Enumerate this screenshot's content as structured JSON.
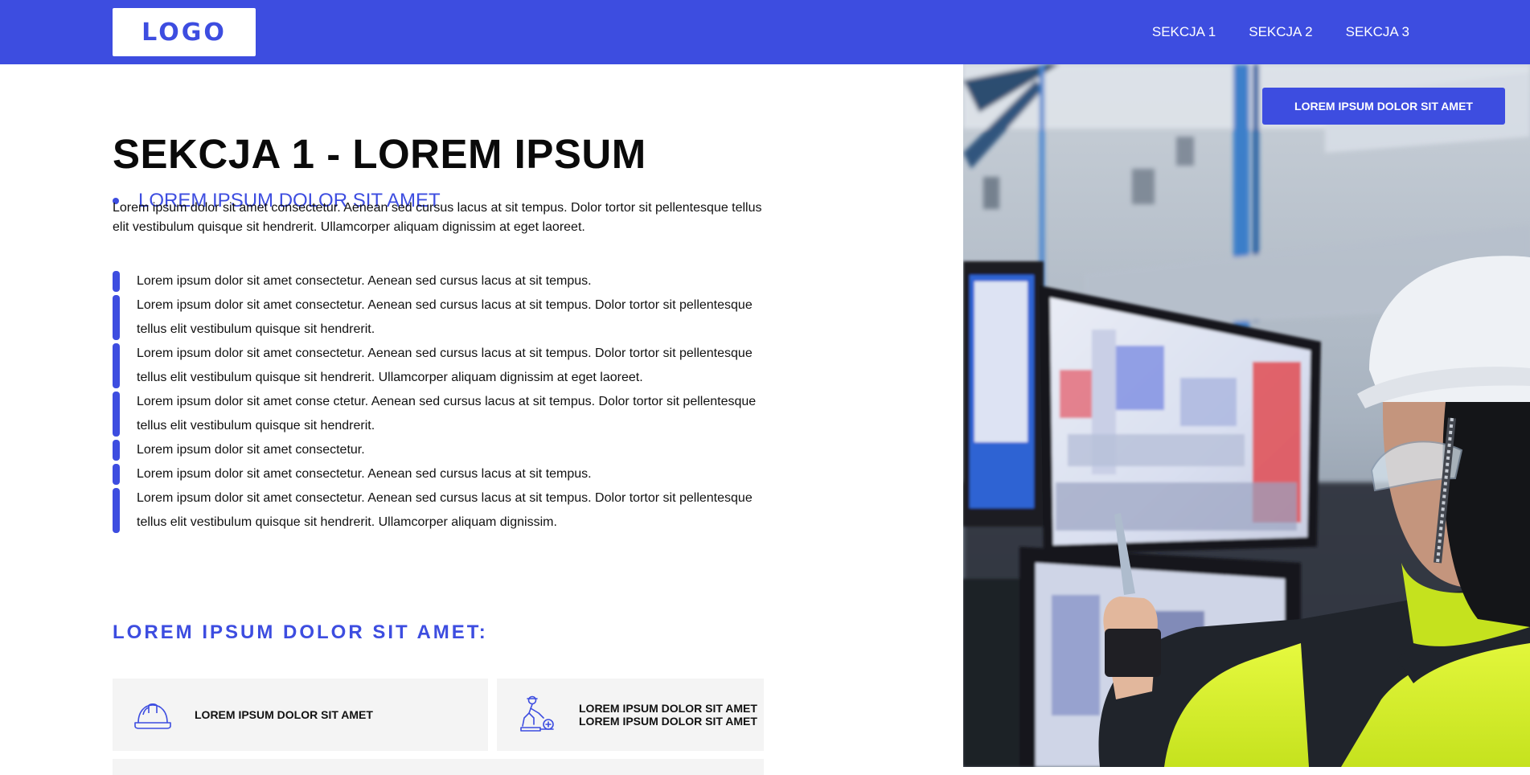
{
  "header": {
    "logo_text": "LOGO",
    "nav": [
      "SEKCJA 1",
      "SEKCJA 2",
      "SEKCJA 3"
    ]
  },
  "main": {
    "title": "SEKCJA 1 - LOREM IPSUM",
    "sub_bullet": "LOREM IPSUM DOLOR SIT AMET",
    "intro": "Lorem ipsum dolor sit amet consectetur. Aenean sed cursus lacus at sit tempus. Dolor tortor sit pellentesque tellus elit vestibulum quisque sit hendrerit. Ullamcorper aliquam dignissim at eget laoreet.",
    "list": [
      "Lorem ipsum dolor sit amet consectetur. Aenean sed cursus lacus at sit tempus.",
      "Lorem ipsum dolor sit amet consectetur. Aenean sed cursus lacus at sit tempus. Dolor tortor sit pellentesque tellus elit vestibulum quisque sit hendrerit.",
      "Lorem ipsum dolor sit amet consectetur. Aenean sed cursus lacus at sit tempus. Dolor tortor sit pellentesque tellus elit vestibulum quisque sit hendrerit. Ullamcorper aliquam dignissim at eget laoreet.",
      "Lorem ipsum dolor sit amet conse ctetur. Aenean sed cursus lacus at sit tempus. Dolor tortor sit pellentesque tellus elit vestibulum quisque sit hendrerit.",
      "Lorem ipsum dolor sit amet consectetur.",
      "Lorem ipsum dolor sit amet consectetur. Aenean sed cursus lacus at sit tempus.",
      "Lorem ipsum dolor sit amet consectetur. Aenean sed cursus lacus at sit tempus. Dolor tortor sit pellentesque tellus elit vestibulum quisque sit hendrerit. Ullamcorper aliquam dignissim."
    ],
    "section_heading": "LOREM IPSUM DOLOR SIT AMET:",
    "cards": [
      {
        "icon": "hard-hat-icon",
        "label": "LOREM IPSUM DOLOR SIT AMET"
      },
      {
        "icon": "first-aid-worker-icon",
        "label_line1": "LOREM IPSUM DOLOR SIT AMET",
        "label_line2": "LOREM IPSUM DOLOR SIT AMET"
      }
    ]
  },
  "hero": {
    "button_label": "LOREM IPSUM DOLOR SIT AMET",
    "image": "engineer-with-hard-hat-at-control-monitors"
  },
  "colors": {
    "brand": "#3d4de0",
    "card_bg": "#f4f4f4",
    "text": "#111111",
    "hi_vis": "#d6f23a"
  }
}
